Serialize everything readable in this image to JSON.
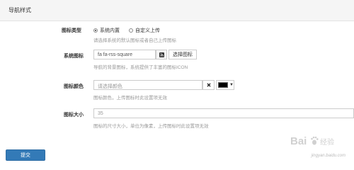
{
  "panel": {
    "title": "导航样式"
  },
  "fields": {
    "icon_type": {
      "label": "图标类型",
      "options": [
        "系统内置",
        "自定义上传"
      ],
      "selected_index": 0,
      "help": "请选择系统的默认图标或者自己上传图标"
    },
    "system_icon": {
      "label": "系统图标",
      "value": "fa fa-rss-square",
      "button_label": "选择图标",
      "preview_icon": "rss-square-icon",
      "help": "导航的背景图标，系统提供了丰富的图标ICON"
    },
    "icon_color": {
      "label": "图标颜色",
      "placeholder": "请选择颜色",
      "clear_icon": "close-icon",
      "swatch_color": "#000000",
      "help": "图标颜色，上传图标时此设置项无效"
    },
    "icon_size": {
      "label": "图标大小",
      "value": "35",
      "help": "图标的尺寸大小，单位为像素，上传图标时此设置项无效"
    }
  },
  "actions": {
    "submit_label": "提交"
  },
  "watermark": {
    "brand": "Bai",
    "brand_suffix": "经验",
    "url": "jingyan.baidu.com"
  },
  "colors": {
    "primary": "#337ab7",
    "help_text": "#999999",
    "header_bg": "#f5f5f5"
  }
}
